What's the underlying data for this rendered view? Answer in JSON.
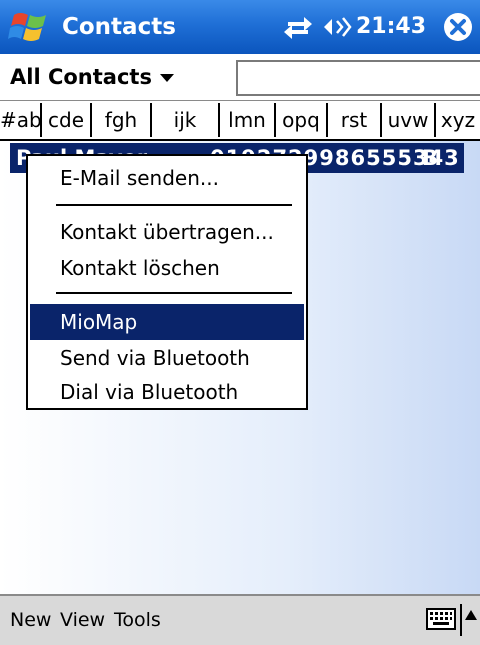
{
  "titlebar": {
    "app_title": "Contacts",
    "clock": "21:43",
    "icons": [
      "windows-start-icon",
      "sync-icon",
      "speaker-icon",
      "close-icon"
    ]
  },
  "filter": {
    "category": "All Contacts",
    "search_value": ""
  },
  "tabs": [
    "#ab",
    "cde",
    "fgh",
    "ijk",
    "lmn",
    "opq",
    "rst",
    "uvw",
    "xyz"
  ],
  "contact": {
    "name": "Paul Mayer",
    "phone": "0192729986555343",
    "type": "B"
  },
  "context_menu": {
    "items": [
      "E-Mail senden...",
      "Kontakt übertragen...",
      "Kontakt löschen",
      "MioMap",
      "Send via Bluetooth",
      "Dial via Bluetooth"
    ],
    "selected": "MioMap"
  },
  "bottombar": {
    "new": "New",
    "view": "View",
    "tools": "Tools"
  },
  "colors": {
    "titlebar": "#1f6fd6",
    "selection": "#0a246a"
  }
}
